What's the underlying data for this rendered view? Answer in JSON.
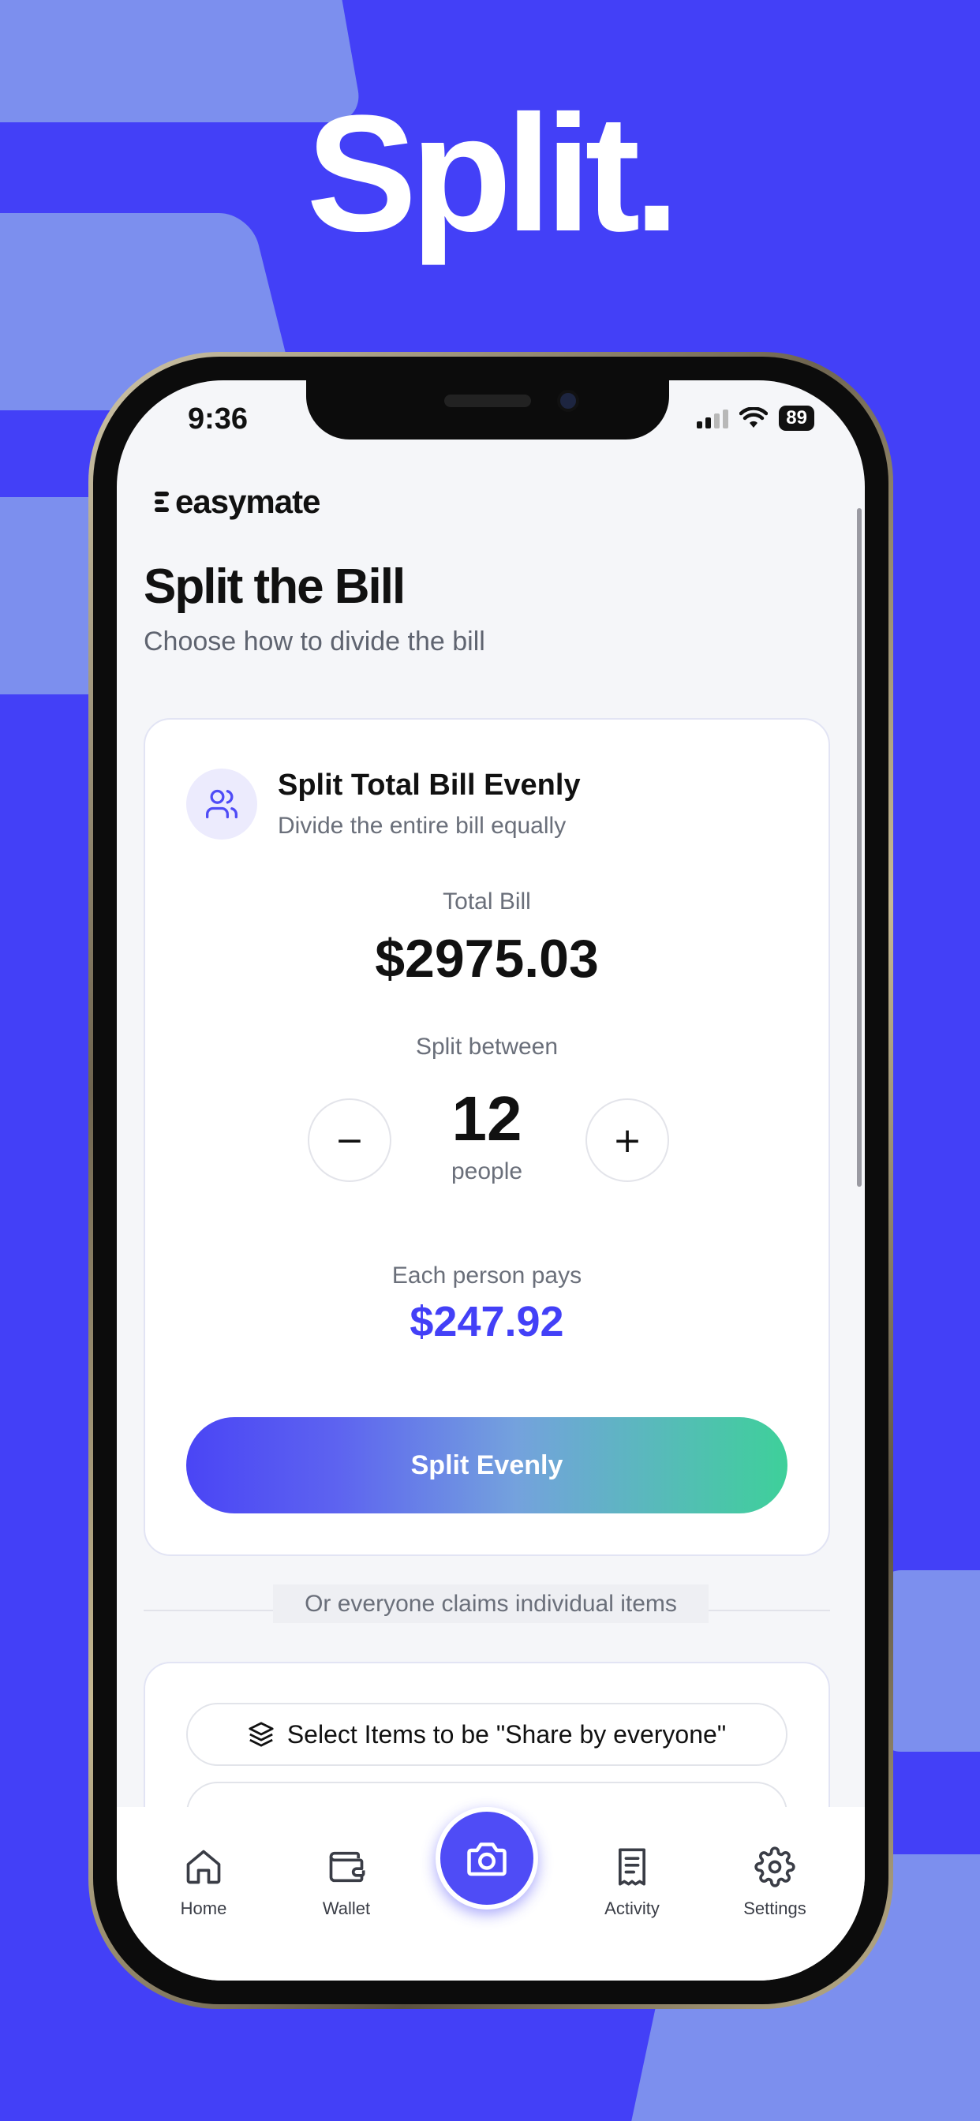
{
  "brand": {
    "title": "Split."
  },
  "status_bar": {
    "time": "9:36",
    "battery": "89"
  },
  "app": {
    "logo_text": "easymate"
  },
  "page": {
    "title": "Split the Bill",
    "subtitle": "Choose how to divide the bill"
  },
  "even_card": {
    "title": "Split Total Bill Evenly",
    "subtitle": "Divide the entire bill equally",
    "total_label": "Total Bill",
    "total_value": "$2975.03",
    "split_label": "Split between",
    "minus_label": "−",
    "plus_label": "+",
    "people_count": "12",
    "people_label": "people",
    "each_label": "Each person pays",
    "each_value": "$247.92",
    "button_label": "Split Evenly"
  },
  "divider": {
    "text": "Or everyone claims individual items"
  },
  "items_card": {
    "share_button_label": "Select Items to be \"Share by everyone\""
  },
  "tab_bar": {
    "items": [
      {
        "label": "Home",
        "icon": "home-icon"
      },
      {
        "label": "Wallet",
        "icon": "wallet-icon"
      },
      {
        "label": "",
        "icon": "camera-icon"
      },
      {
        "label": "Activity",
        "icon": "receipt-icon"
      },
      {
        "label": "Settings",
        "icon": "gear-icon"
      }
    ]
  },
  "colors": {
    "background": "#4340F7",
    "accent": "#4340F7",
    "gradient_start": "#4a45f5",
    "gradient_end": "#3ed09a"
  }
}
